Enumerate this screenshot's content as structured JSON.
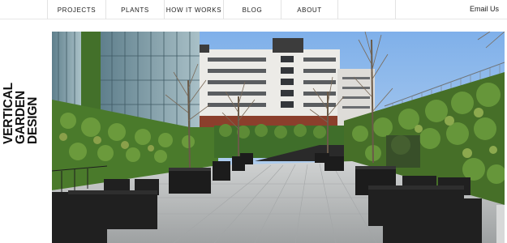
{
  "nav": {
    "items": [
      "PROJECTS",
      "PLANTS",
      "HOW IT WORKS",
      "BLOG",
      "ABOUT"
    ],
    "email_label": "Email Us"
  },
  "logo": {
    "lines": [
      "VERTICAL",
      "GARDEN",
      "DESIGN"
    ]
  },
  "hero": {
    "subject": "courtyard-with-living-walls-photo"
  },
  "colors": {
    "sky": "#8fb7e6",
    "foliage": "#4f7a2e",
    "paving": "#b9bcbd",
    "furniture": "#1a1a1a"
  }
}
